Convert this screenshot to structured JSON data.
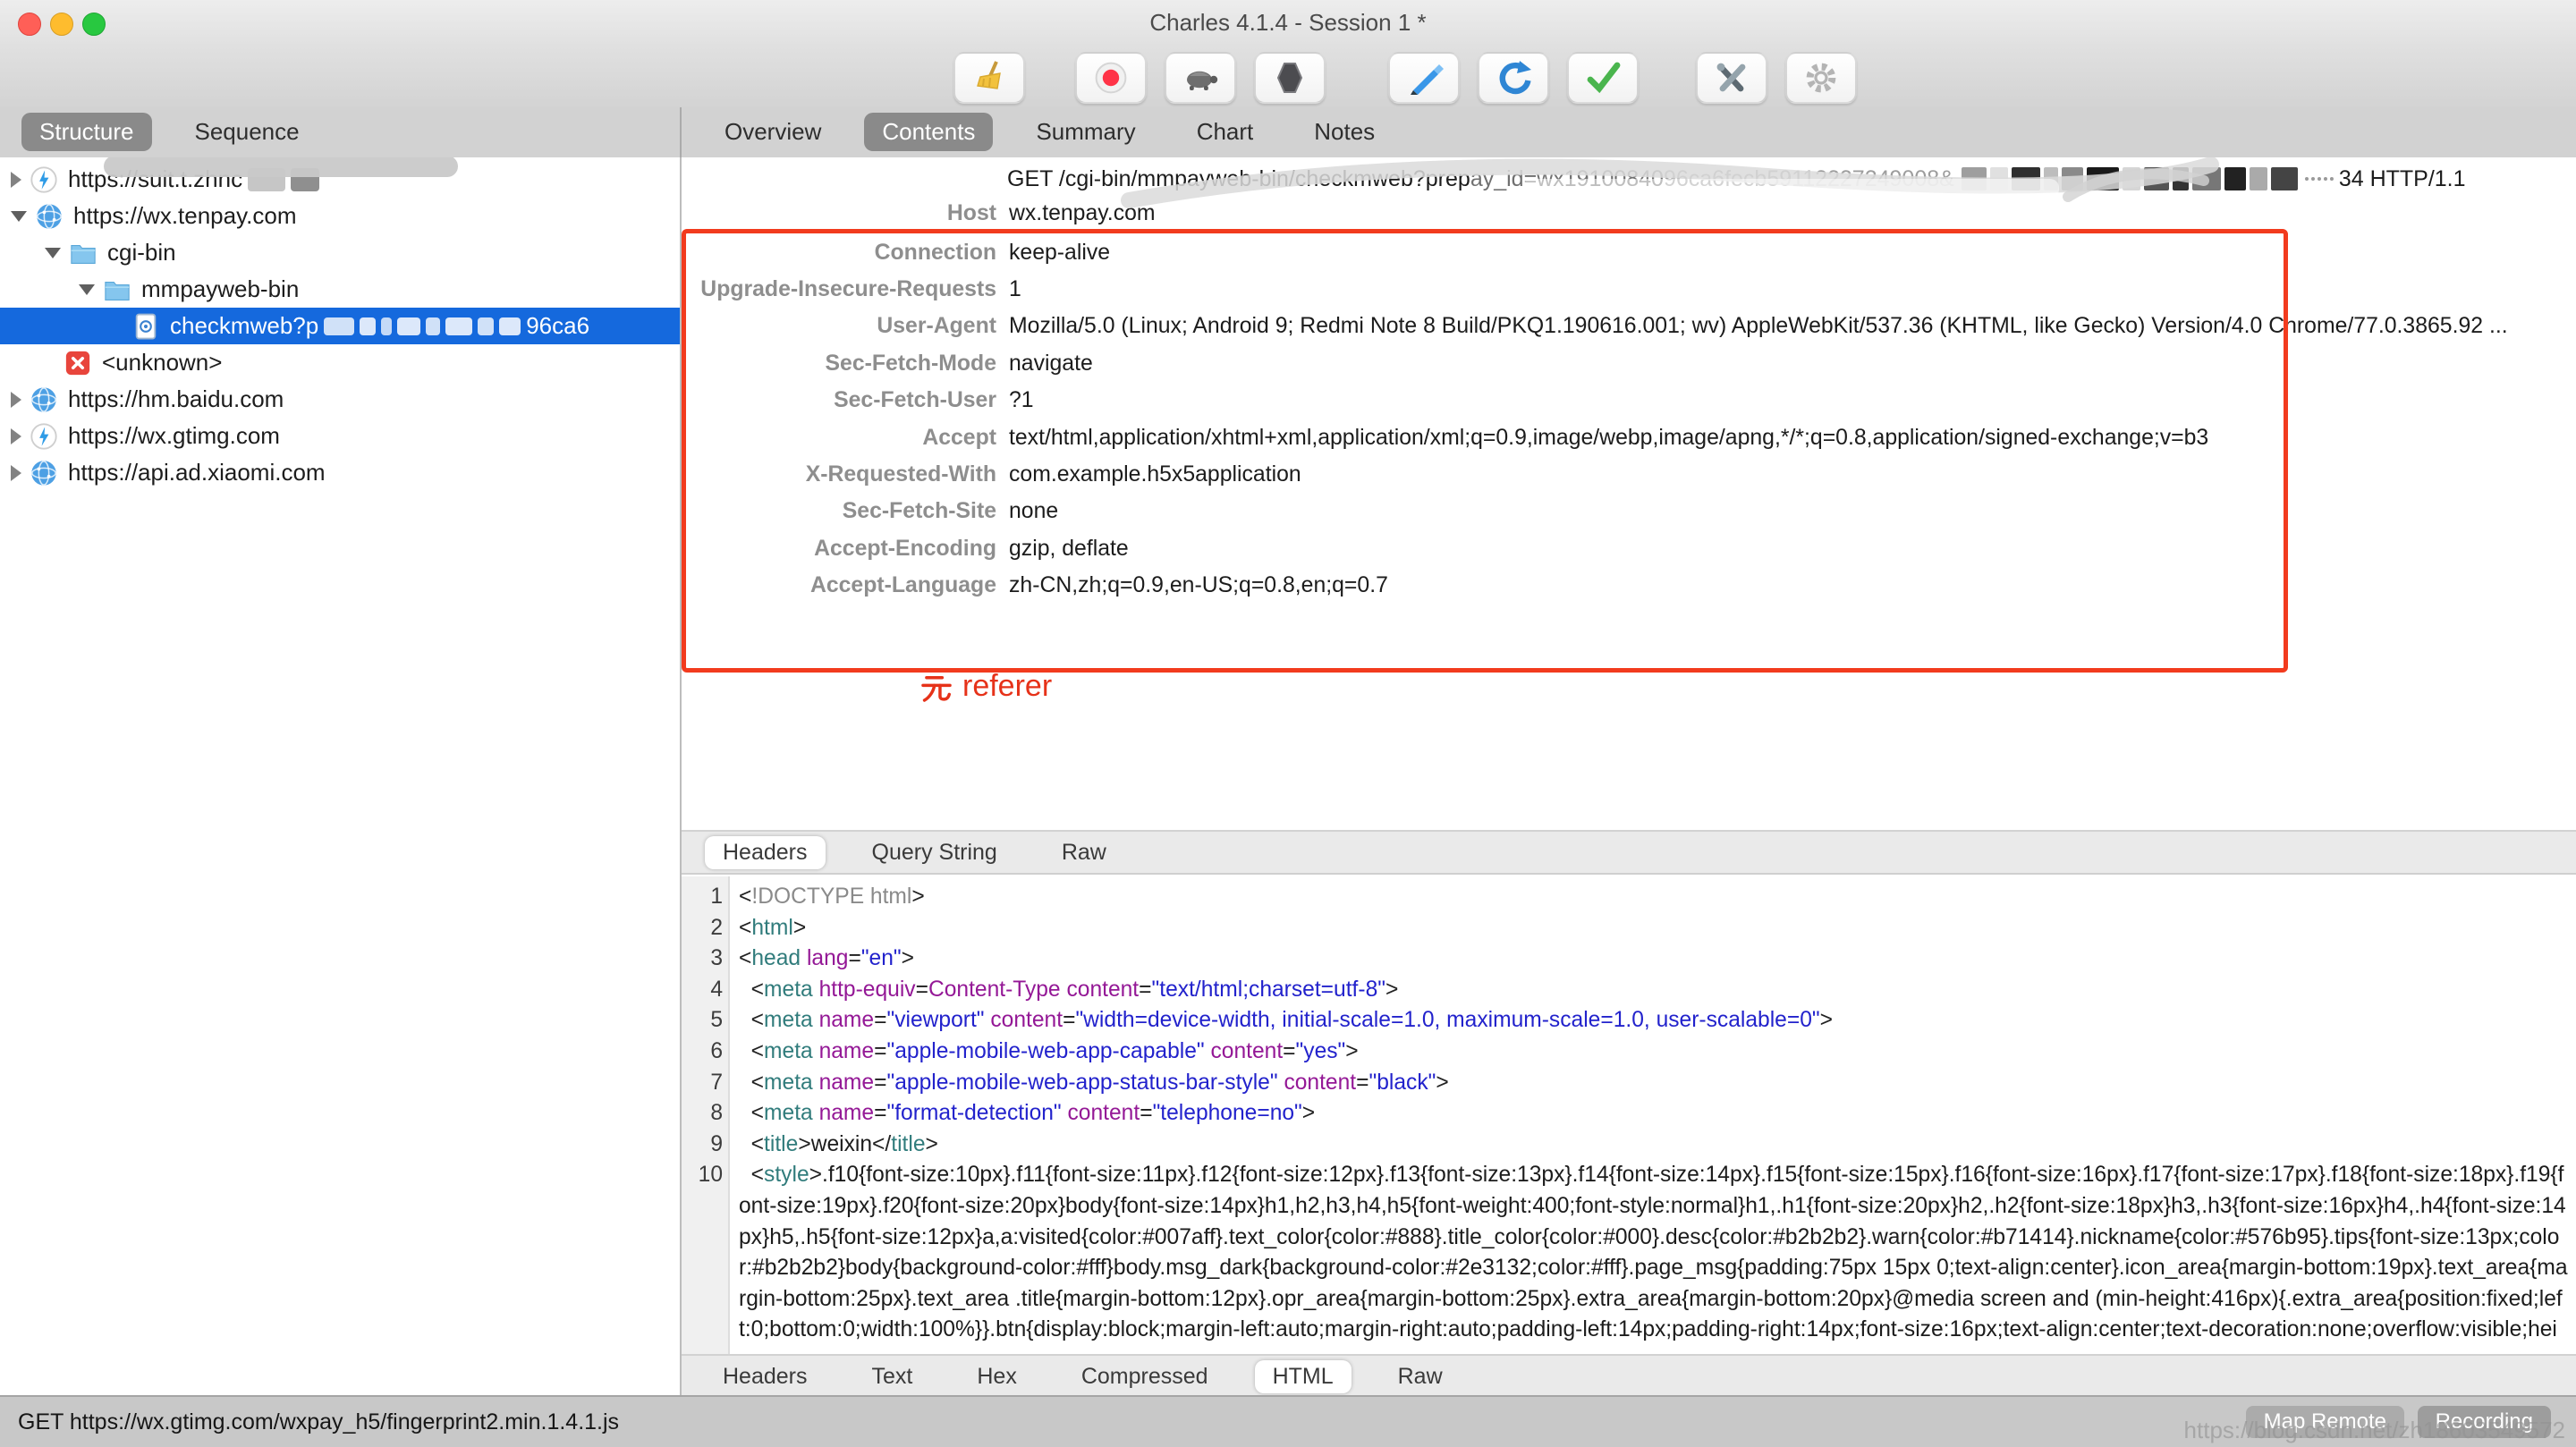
{
  "window": {
    "title": "Charles 4.1.4 - Session 1 *"
  },
  "toolbar": {
    "buttons": [
      "broom",
      "record",
      "throttle-turtle",
      "breakpoints-hexagon",
      "compose-pen",
      "refresh",
      "validate-check",
      "tools",
      "settings-gear"
    ]
  },
  "sidebar": {
    "tabs": [
      {
        "label": "Structure",
        "selected": true
      },
      {
        "label": "Sequence",
        "selected": false
      }
    ],
    "tree": [
      {
        "indent": 0,
        "arrow": "r",
        "icon": "lightning",
        "label": "https://suit.t.zhnc",
        "redacted_tail": true,
        "smudged": true,
        "selected": false
      },
      {
        "indent": 0,
        "arrow": "d",
        "icon": "globe",
        "label": "https://wx.tenpay.com",
        "selected": false
      },
      {
        "indent": 1,
        "arrow": "d",
        "icon": "folder",
        "label": "cgi-bin",
        "selected": false
      },
      {
        "indent": 2,
        "arrow": "d",
        "icon": "folder",
        "label": "mmpayweb-bin",
        "selected": false
      },
      {
        "indent": 3,
        "arrow": "n",
        "icon": "doc",
        "label": "checkmweb?p",
        "redacted_mid": true,
        "tail": "96ca6",
        "selected": true
      },
      {
        "indent": 1,
        "arrow": "n",
        "icon": "error",
        "label": "<unknown>",
        "selected": false
      },
      {
        "indent": 0,
        "arrow": "r",
        "icon": "globe",
        "label": "https://hm.baidu.com",
        "selected": false
      },
      {
        "indent": 0,
        "arrow": "r",
        "icon": "lightning",
        "label": "https://wx.gtimg.com",
        "selected": false
      },
      {
        "indent": 0,
        "arrow": "r",
        "icon": "globe",
        "label": "https://api.ad.xiaomi.com",
        "selected": false
      }
    ]
  },
  "content_tabs": [
    {
      "label": "Overview",
      "selected": false
    },
    {
      "label": "Contents",
      "selected": true
    },
    {
      "label": "Summary",
      "selected": false
    },
    {
      "label": "Chart",
      "selected": false
    },
    {
      "label": "Notes",
      "selected": false
    }
  ],
  "request": {
    "line": {
      "method_path": "GET /cgi-bin/mmpayweb-bin/checkmweb?prep",
      "faded_segment_1": "ay_id=wx19100840",
      "faded_segment_2": "96ca6fecb59112227249008&",
      "tail": "34 HTTP/1.1"
    },
    "host": {
      "label": "Host",
      "value": "wx.tenpay.com"
    },
    "headers": [
      {
        "name": "Connection",
        "value": "keep-alive"
      },
      {
        "name": "Upgrade-Insecure-Requests",
        "value": "1"
      },
      {
        "name": "User-Agent",
        "value": "Mozilla/5.0 (Linux; Android 9; Redmi Note 8 Build/PKQ1.190616.001; wv) AppleWebKit/537.36 (KHTML, like Gecko) Version/4.0 Chrome/77.0.3865.92 ..."
      },
      {
        "name": "Sec-Fetch-Mode",
        "value": "navigate"
      },
      {
        "name": "Sec-Fetch-User",
        "value": "?1"
      },
      {
        "name": "Accept",
        "value": "text/html,application/xhtml+xml,application/xml;q=0.9,image/webp,image/apng,*/*;q=0.8,application/signed-exchange;v=b3"
      },
      {
        "name": "X-Requested-With",
        "value": "com.example.h5x5application"
      },
      {
        "name": "Sec-Fetch-Site",
        "value": "none"
      },
      {
        "name": "Accept-Encoding",
        "value": "gzip, deflate"
      },
      {
        "name": "Accept-Language",
        "value": "zh-CN,zh;q=0.9,en-US;q=0.8,en;q=0.7"
      }
    ]
  },
  "annotation": {
    "text": "无 referer",
    "latin_part": "referer",
    "color": "#e63219",
    "box_color": "#f23b1e"
  },
  "request_view_tabs": {
    "items": [
      "Headers",
      "Query String",
      "Raw"
    ],
    "selected": "Headers"
  },
  "response_view_tabs": {
    "items": [
      "Headers",
      "Text",
      "Hex",
      "Compressed",
      "HTML",
      "Raw"
    ],
    "selected": "HTML"
  },
  "code": {
    "lines": [
      {
        "no": "1",
        "tokens": [
          [
            "b",
            "<"
          ],
          [
            "g",
            "!DOCTYPE html"
          ],
          [
            "b",
            ">"
          ]
        ]
      },
      {
        "no": "2",
        "tokens": [
          [
            "b",
            "<"
          ],
          [
            "t",
            "html"
          ],
          [
            "b",
            ">"
          ]
        ]
      },
      {
        "no": "3",
        "tokens": [
          [
            "b",
            "<"
          ],
          [
            "t",
            "head"
          ],
          [
            "p",
            " "
          ],
          [
            "a",
            "lang"
          ],
          [
            "p",
            "="
          ],
          [
            "v",
            "\"en\""
          ],
          [
            "b",
            ">"
          ]
        ]
      },
      {
        "no": "4",
        "tokens": [
          [
            "p",
            "  "
          ],
          [
            "b",
            "<"
          ],
          [
            "t",
            "meta"
          ],
          [
            "p",
            " "
          ],
          [
            "a",
            "http-equiv"
          ],
          [
            "p",
            "="
          ],
          [
            "a",
            "Content-Type"
          ],
          [
            "p",
            " "
          ],
          [
            "a",
            "content"
          ],
          [
            "p",
            "="
          ],
          [
            "v",
            "\"text/html;charset=utf-8\""
          ],
          [
            "b",
            ">"
          ]
        ]
      },
      {
        "no": "5",
        "tokens": [
          [
            "p",
            "  "
          ],
          [
            "b",
            "<"
          ],
          [
            "t",
            "meta"
          ],
          [
            "p",
            " "
          ],
          [
            "a",
            "name"
          ],
          [
            "p",
            "="
          ],
          [
            "v",
            "\"viewport\""
          ],
          [
            "p",
            " "
          ],
          [
            "a",
            "content"
          ],
          [
            "p",
            "="
          ],
          [
            "v",
            "\"width=device-width, initial-scale=1.0, maximum-scale=1.0, user-scalable=0\""
          ],
          [
            "b",
            ">"
          ]
        ]
      },
      {
        "no": "6",
        "tokens": [
          [
            "p",
            "  "
          ],
          [
            "b",
            "<"
          ],
          [
            "t",
            "meta"
          ],
          [
            "p",
            " "
          ],
          [
            "a",
            "name"
          ],
          [
            "p",
            "="
          ],
          [
            "v",
            "\"apple-mobile-web-app-capable\""
          ],
          [
            "p",
            " "
          ],
          [
            "a",
            "content"
          ],
          [
            "p",
            "="
          ],
          [
            "v",
            "\"yes\""
          ],
          [
            "b",
            ">"
          ]
        ]
      },
      {
        "no": "7",
        "tokens": [
          [
            "p",
            "  "
          ],
          [
            "b",
            "<"
          ],
          [
            "t",
            "meta"
          ],
          [
            "p",
            " "
          ],
          [
            "a",
            "name"
          ],
          [
            "p",
            "="
          ],
          [
            "v",
            "\"apple-mobile-web-app-status-bar-style\""
          ],
          [
            "p",
            " "
          ],
          [
            "a",
            "content"
          ],
          [
            "p",
            "="
          ],
          [
            "v",
            "\"black\""
          ],
          [
            "b",
            ">"
          ]
        ]
      },
      {
        "no": "8",
        "tokens": [
          [
            "p",
            "  "
          ],
          [
            "b",
            "<"
          ],
          [
            "t",
            "meta"
          ],
          [
            "p",
            " "
          ],
          [
            "a",
            "name"
          ],
          [
            "p",
            "="
          ],
          [
            "v",
            "\"format-detection\""
          ],
          [
            "p",
            " "
          ],
          [
            "a",
            "content"
          ],
          [
            "p",
            "="
          ],
          [
            "v",
            "\"telephone=no\""
          ],
          [
            "b",
            ">"
          ]
        ]
      },
      {
        "no": "9",
        "tokens": [
          [
            "p",
            "  "
          ],
          [
            "b",
            "<"
          ],
          [
            "t",
            "title"
          ],
          [
            "b",
            ">"
          ],
          [
            "p",
            "weixin"
          ],
          [
            "b",
            "</"
          ],
          [
            "t",
            "title"
          ],
          [
            "b",
            ">"
          ]
        ]
      },
      {
        "no": "10",
        "tokens": [
          [
            "p",
            "  "
          ],
          [
            "b",
            "<"
          ],
          [
            "t",
            "style"
          ],
          [
            "b",
            ">"
          ],
          [
            "p",
            ".f10{font-size:10px}.f11{font-size:11px}.f12{font-size:12px}.f13{font-size:13px}.f14{font-size:14px}.f15{font-size:15px}.f16{font-size:16px}.f17{font-size:17px}.f18{font-size:18px}.f19{font-size:19px}.f20{font-size:20px}body{font-size:14px}h1,h2,h3,h4,h5{font-weight:400;font-style:normal}h1,.h1{font-size:20px}h2,.h2{font-size:18px}h3,.h3{font-size:16px}h4,.h4{font-size:14px}h5,.h5{font-size:12px}a,a:visited{color:#007aff}.text_color{color:#888}.title_color{color:#000}.desc{color:#b2b2b2}.warn{color:#b71414}.nickname{color:#576b95}.tips{font-size:13px;color:#b2b2b2}body{background-color:#fff}body.msg_dark{background-color:#2e3132;color:#fff}.page_msg{padding:75px 15px 0;text-align:center}.icon_area{margin-bottom:19px}.text_area{margin-bottom:25px}.text_area .title{margin-bottom:12px}.opr_area{margin-bottom:25px}.extra_area{margin-bottom:20px}@media screen and (min-height:416px){.extra_area{position:fixed;left:0;bottom:0;width:100%}}.btn{display:block;margin-left:auto;margin-right:auto;padding-left:14px;padding-right:14px;font-size:16px;text-align:center;text-decoration:none;overflow:visible;hei"
          ]
        ]
      }
    ]
  },
  "statusbar": {
    "text": "GET https://wx.gtimg.com/wxpay_h5/fingerprint2.min.1.4.1.js",
    "buttons": [
      {
        "label": "Map Remote"
      },
      {
        "label": "Recording"
      }
    ],
    "watermark": "https://blog.csdn.net/zh18603549572"
  }
}
